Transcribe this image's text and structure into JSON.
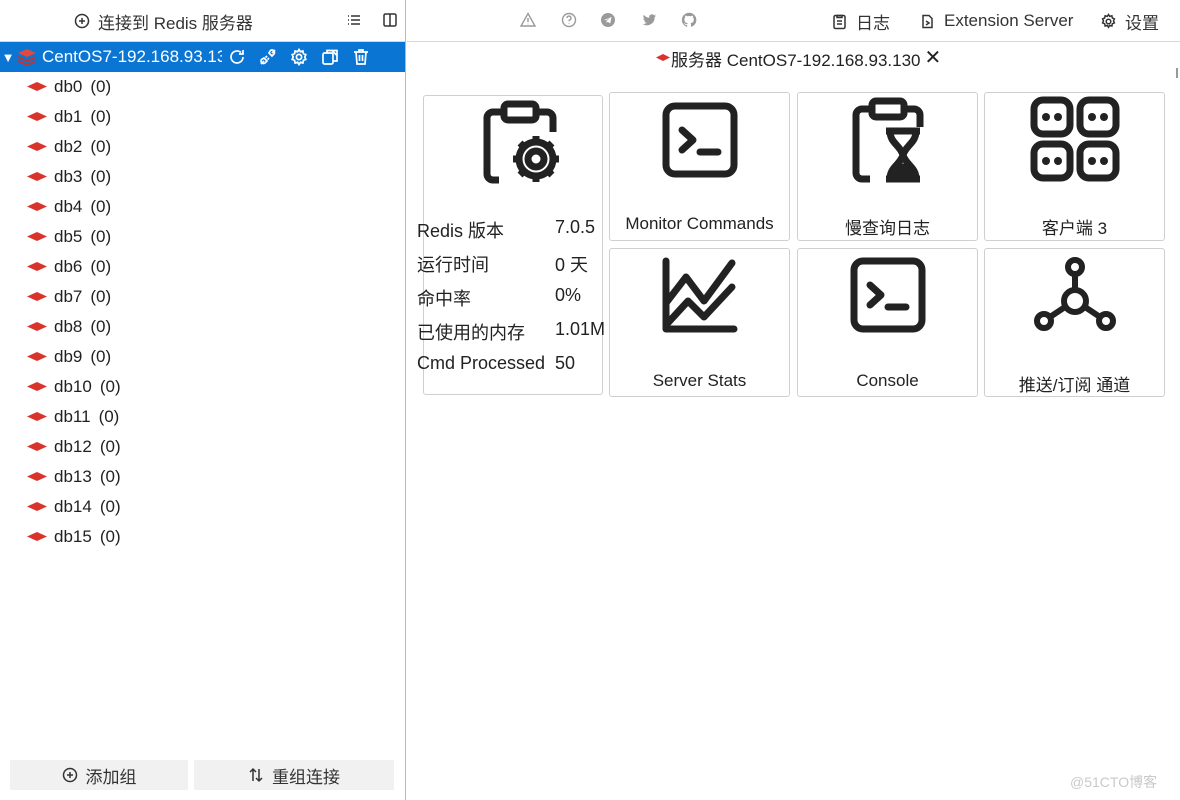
{
  "left_panel": {
    "connect_button": "连接到 Redis 服务器",
    "server": {
      "name": "CentOS7-192.168.93.130",
      "expanded": true
    },
    "databases": [
      {
        "name": "db0",
        "count": "(0)"
      },
      {
        "name": "db1",
        "count": "(0)"
      },
      {
        "name": "db2",
        "count": "(0)"
      },
      {
        "name": "db3",
        "count": "(0)"
      },
      {
        "name": "db4",
        "count": "(0)"
      },
      {
        "name": "db5",
        "count": "(0)"
      },
      {
        "name": "db6",
        "count": "(0)"
      },
      {
        "name": "db7",
        "count": "(0)"
      },
      {
        "name": "db8",
        "count": "(0)"
      },
      {
        "name": "db9",
        "count": "(0)"
      },
      {
        "name": "db10",
        "count": "(0)"
      },
      {
        "name": "db11",
        "count": "(0)"
      },
      {
        "name": "db12",
        "count": "(0)"
      },
      {
        "name": "db13",
        "count": "(0)"
      },
      {
        "name": "db14",
        "count": "(0)"
      },
      {
        "name": "db15",
        "count": "(0)"
      }
    ],
    "add_group_button": "添加组",
    "reorder_button": "重组连接"
  },
  "top_bar": {
    "log_button": "日志",
    "extension_button": "Extension Server",
    "settings_button": "设置",
    "icons": [
      "warning-icon",
      "help-icon",
      "telegram-icon",
      "twitter-icon",
      "github-icon"
    ]
  },
  "tab": {
    "label": "服务器 CentOS7-192.168.93.130",
    "close": "✕"
  },
  "info": [
    {
      "key": "Redis 版本",
      "value": "7.0.5"
    },
    {
      "key": "运行时间",
      "value": "0 天"
    },
    {
      "key": "命中率",
      "value": "0%"
    },
    {
      "key": "已使用的内存",
      "value": "1.01M"
    },
    {
      "key": "Cmd Processed",
      "value": "50"
    }
  ],
  "cards": {
    "monitor": "Monitor Commands",
    "slowlog": "慢查询日志",
    "clients": "客户端 3",
    "stats": "Server Stats",
    "console": "Console",
    "pubsub": "推送/订阅 通道"
  },
  "colors": {
    "selection": "#0b75d3",
    "redis_red": "#d9342b",
    "icon_dark": "#222222",
    "icon_grey": "#9a9a9a"
  },
  "watermark": "@51CTO博客"
}
